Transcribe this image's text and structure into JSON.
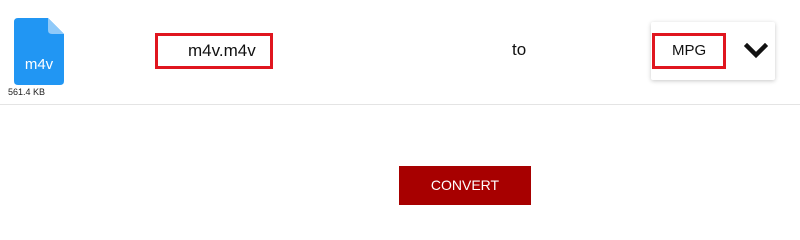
{
  "file": {
    "extension": "m4v",
    "size": "561.4 KB",
    "name": "m4v.m4v"
  },
  "conversion": {
    "to_label": "to",
    "target_format": "MPG"
  },
  "actions": {
    "convert_label": "CONVERT"
  },
  "colors": {
    "file_icon": "#2196f3",
    "file_icon_fold": "#90caf9",
    "highlight_border": "#e0161f",
    "convert_button": "#a70000"
  },
  "icons": {
    "file": "file-icon",
    "dropdown": "chevron-down-icon"
  }
}
